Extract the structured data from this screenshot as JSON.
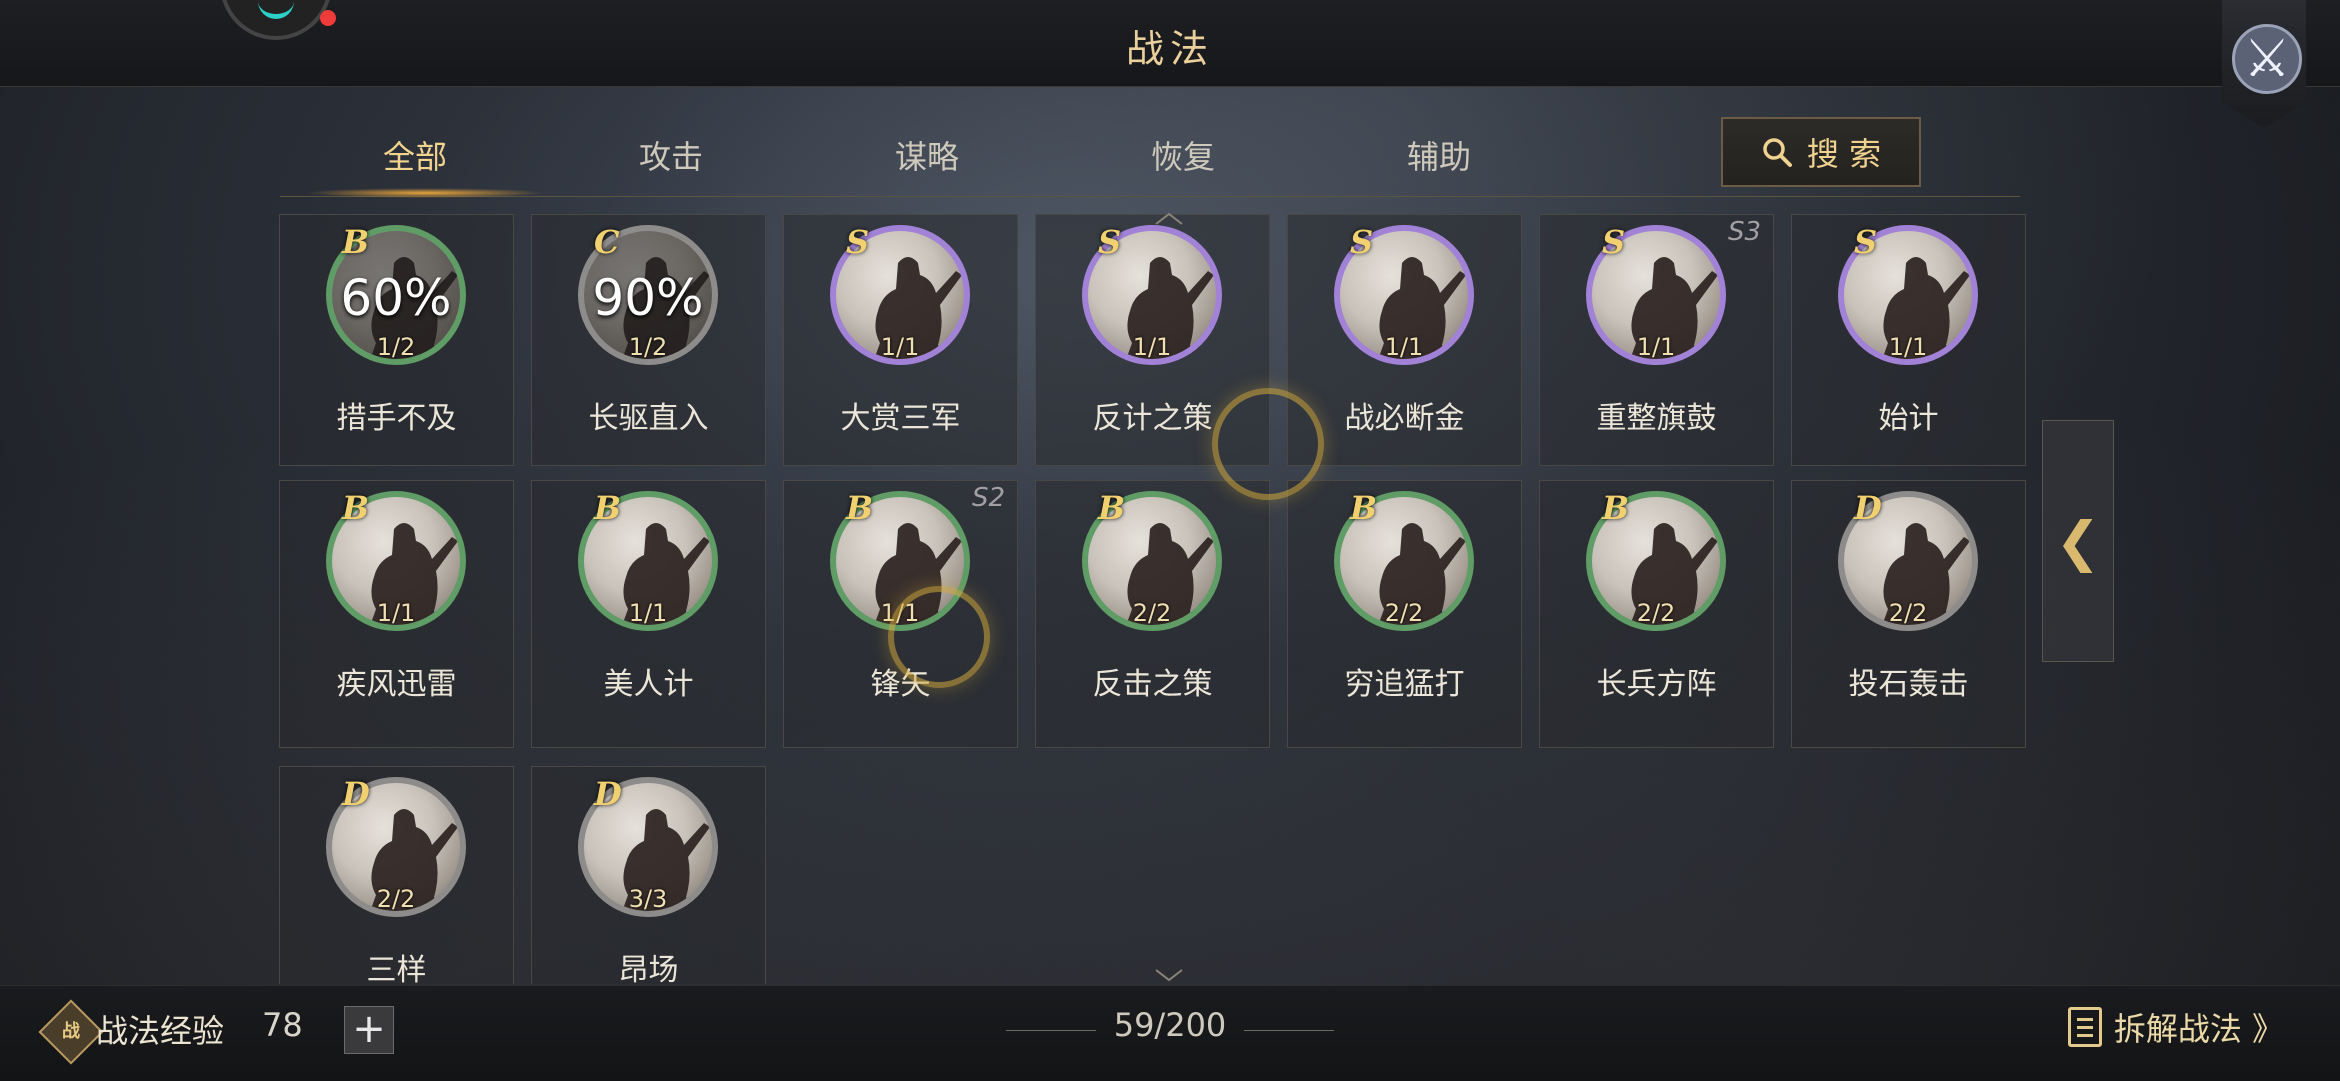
{
  "header": {
    "title": "战法"
  },
  "tabs": [
    {
      "label": "全部",
      "active": true
    },
    {
      "label": "攻击",
      "active": false
    },
    {
      "label": "谋略",
      "active": false
    },
    {
      "label": "恢复",
      "active": false
    },
    {
      "label": "辅助",
      "active": false
    }
  ],
  "search": {
    "label": "搜 索",
    "icon": "search-icon"
  },
  "skills": [
    {
      "grade": "B",
      "name": "措手不及",
      "count": "1/2",
      "percent": "60%",
      "ring": "green",
      "season": ""
    },
    {
      "grade": "C",
      "name": "长驱直入",
      "count": "1/2",
      "percent": "90%",
      "ring": "gray",
      "season": ""
    },
    {
      "grade": "S",
      "name": "大赏三军",
      "count": "1/1",
      "percent": "",
      "ring": "purple",
      "season": ""
    },
    {
      "grade": "S",
      "name": "反计之策",
      "count": "1/1",
      "percent": "",
      "ring": "purple",
      "season": ""
    },
    {
      "grade": "S",
      "name": "战必断金",
      "count": "1/1",
      "percent": "",
      "ring": "purple",
      "season": ""
    },
    {
      "grade": "S",
      "name": "重整旗鼓",
      "count": "1/1",
      "percent": "",
      "ring": "purple",
      "season": "S3"
    },
    {
      "grade": "S",
      "name": "始计",
      "count": "1/1",
      "percent": "",
      "ring": "purple",
      "season": ""
    },
    {
      "grade": "B",
      "name": "疾风迅雷",
      "count": "1/1",
      "percent": "",
      "ring": "green",
      "season": ""
    },
    {
      "grade": "B",
      "name": "美人计",
      "count": "1/1",
      "percent": "",
      "ring": "green",
      "season": ""
    },
    {
      "grade": "B",
      "name": "锋矢",
      "count": "1/1",
      "percent": "",
      "ring": "green",
      "season": "S2"
    },
    {
      "grade": "B",
      "name": "反击之策",
      "count": "2/2",
      "percent": "",
      "ring": "green",
      "season": ""
    },
    {
      "grade": "B",
      "name": "穷追猛打",
      "count": "2/2",
      "percent": "",
      "ring": "green",
      "season": ""
    },
    {
      "grade": "B",
      "name": "长兵方阵",
      "count": "2/2",
      "percent": "",
      "ring": "green",
      "season": ""
    },
    {
      "grade": "D",
      "name": "投石轰击",
      "count": "2/2",
      "percent": "",
      "ring": "gray",
      "season": ""
    },
    {
      "grade": "D",
      "name": "三样",
      "count": "2/2",
      "percent": "",
      "ring": "gray",
      "season": ""
    },
    {
      "grade": "D",
      "name": "昂场",
      "count": "3/3",
      "percent": "",
      "ring": "gray",
      "season": ""
    }
  ],
  "footer": {
    "exp_icon_text": "战",
    "exp_label": "战法经验",
    "exp_value": "78",
    "plus_label": "+",
    "capacity": "59/200",
    "dismantle_label": "拆解战法 》"
  },
  "side_arrow": "❮",
  "colors": {
    "accent": "#f2d48f",
    "purple_ring": "#a182d6",
    "green_ring": "#5f9c66",
    "gray_ring": "#8e8c8a"
  }
}
